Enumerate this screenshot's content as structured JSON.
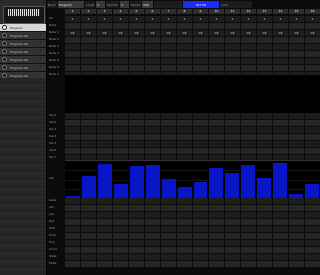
{
  "app": {
    "logo_mark": "",
    "logo_caption": "",
    "programs": [
      {
        "label": "Program",
        "active": true
      },
      {
        "label": "Program list",
        "active": false
      },
      {
        "label": "Program list",
        "active": false
      },
      {
        "label": "Program list",
        "active": false
      },
      {
        "label": "Program list",
        "active": false
      },
      {
        "label": "Program list",
        "active": false
      },
      {
        "label": "Program list",
        "active": false
      }
    ]
  },
  "header": {
    "bank_label": "Bank",
    "program_name": "Program",
    "level_label": "Level",
    "level_value": "1",
    "section_label": "Section",
    "section_value": "1",
    "tempo_label": "Tempo",
    "tempo_value": "120",
    "sync_badge": "INT 96",
    "extra_value": "1/16"
  },
  "columns": [
    "1",
    "2",
    "3",
    "4",
    "5",
    "6",
    "7",
    "8",
    "9",
    "10",
    "11",
    "12",
    "13",
    "14",
    "15",
    "16"
  ],
  "grid_top": {
    "rows": [
      {
        "label": "Ch",
        "values": [
          "1",
          "1",
          "1",
          "1",
          "1",
          "1",
          "1",
          "1",
          "1",
          "1",
          "1",
          "1",
          "1",
          "1",
          "1",
          "1"
        ]
      },
      {
        "label": "Note",
        "values": [
          "",
          "",
          "",
          "",
          "",
          "",
          "",
          "",
          "",
          "",
          "",
          "",
          "",
          "",
          "",
          ""
        ]
      },
      {
        "label": "Note 1",
        "values": [
          "C4",
          "C4",
          "C4",
          "C4",
          "C4",
          "C4",
          "C4",
          "C4",
          "C4",
          "C4",
          "C4",
          "C4",
          "C4",
          "C4",
          "C4",
          "C4"
        ]
      },
      {
        "label": "Note 2",
        "values": [
          "",
          "",
          "",
          "",
          "",
          "",
          "",
          "",
          "",
          "",
          "",
          "",
          "",
          "",
          "",
          ""
        ]
      },
      {
        "label": "Note 3",
        "values": [
          "",
          "",
          "",
          "",
          "",
          "",
          "",
          "",
          "",
          "",
          "",
          "",
          "",
          "",
          "",
          ""
        ]
      },
      {
        "label": "Note 4",
        "values": [
          "",
          "",
          "",
          "",
          "",
          "",
          "",
          "",
          "",
          "",
          "",
          "",
          "",
          "",
          "",
          ""
        ]
      },
      {
        "label": "Note 5",
        "values": [
          "",
          "",
          "",
          "",
          "",
          "",
          "",
          "",
          "",
          "",
          "",
          "",
          "",
          "",
          "",
          ""
        ]
      },
      {
        "label": "Note 6",
        "values": [
          "",
          "",
          "",
          "",
          "",
          "",
          "",
          "",
          "",
          "",
          "",
          "",
          "",
          "",
          "",
          ""
        ]
      },
      {
        "label": "Note 7",
        "values": [
          "",
          "",
          "",
          "",
          "",
          "",
          "",
          "",
          "",
          "",
          "",
          "",
          "",
          "",
          "",
          ""
        ]
      }
    ]
  },
  "grid_mid": {
    "rows": [
      {
        "label": "Vel 1",
        "values": [
          "",
          "",
          "",
          "",
          "",
          "",
          "",
          "",
          "",
          "",
          "",
          "",
          "",
          "",
          "",
          ""
        ]
      },
      {
        "label": "Vel 2",
        "values": [
          "",
          "",
          "",
          "",
          "",
          "",
          "",
          "",
          "",
          "",
          "",
          "",
          "",
          "",
          "",
          ""
        ]
      },
      {
        "label": "Vel 3",
        "values": [
          "",
          "",
          "",
          "",
          "",
          "",
          "",
          "",
          "",
          "",
          "",
          "",
          "",
          "",
          "",
          ""
        ]
      },
      {
        "label": "Vel 4",
        "values": [
          "",
          "",
          "",
          "",
          "",
          "",
          "",
          "",
          "",
          "",
          "",
          "",
          "",
          "",
          "",
          ""
        ]
      },
      {
        "label": "Vel 5",
        "values": [
          "",
          "",
          "",
          "",
          "",
          "",
          "",
          "",
          "",
          "",
          "",
          "",
          "",
          "",
          "",
          ""
        ]
      },
      {
        "label": "Vel 6",
        "values": [
          "",
          "",
          "",
          "",
          "",
          "",
          "",
          "",
          "",
          "",
          "",
          "",
          "",
          "",
          "",
          ""
        ]
      },
      {
        "label": "Vel 7",
        "values": [
          "",
          "",
          "",
          "",
          "",
          "",
          "",
          "",
          "",
          "",
          "",
          "",
          "",
          "",
          "",
          ""
        ]
      }
    ]
  },
  "bars": {
    "label": "Vel",
    "values": [
      0.05,
      0.62,
      0.95,
      0.38,
      0.88,
      0.92,
      0.52,
      0.3,
      0.45,
      0.82,
      0.7,
      0.93,
      0.55,
      0.98,
      0.12,
      0.4
    ]
  },
  "grid_bottom": {
    "rows": [
      {
        "label": "Gate",
        "values": [
          "",
          "",
          "",
          "",
          "",
          "",
          "",
          "",
          "",
          "",
          "",
          "",
          "",
          "",
          "",
          ""
        ]
      },
      {
        "label": "Vel",
        "values": [
          "",
          "",
          "",
          "",
          "",
          "",
          "",
          "",
          "",
          "",
          "",
          "",
          "",
          "",
          "",
          ""
        ]
      },
      {
        "label": "Len",
        "values": [
          "",
          "",
          "",
          "",
          "",
          "",
          "",
          "",
          "",
          "",
          "",
          "",
          "",
          "",
          "",
          ""
        ]
      },
      {
        "label": "Rpt",
        "values": [
          "",
          "",
          "",
          "",
          "",
          "",
          "",
          "",
          "",
          "",
          "",
          "",
          "",
          "",
          "",
          ""
        ]
      },
      {
        "label": "Mod",
        "values": [
          "",
          "",
          "",
          "",
          "",
          "",
          "",
          "",
          "",
          "",
          "",
          "",
          "",
          "",
          "",
          ""
        ]
      },
      {
        "label": "Prob",
        "values": [
          "",
          "",
          "",
          "",
          "",
          "",
          "",
          "",
          "",
          "",
          "",
          "",
          "",
          "",
          "",
          ""
        ]
      },
      {
        "label": "Trig",
        "values": [
          "",
          "",
          "",
          "",
          "",
          "",
          "",
          "",
          "",
          "",
          "",
          "",
          "",
          "",
          "",
          ""
        ]
      },
      {
        "label": "Cond",
        "values": [
          "",
          "",
          "",
          "",
          "",
          "",
          "",
          "",
          "",
          "",
          "",
          "",
          "",
          "",
          "",
          ""
        ]
      },
      {
        "label": "Slide",
        "values": [
          "",
          "",
          "",
          "",
          "",
          "",
          "",
          "",
          "",
          "",
          "",
          "",
          "",
          "",
          "",
          ""
        ]
      },
      {
        "label": "Mute",
        "values": [
          "",
          "",
          "",
          "",
          "",
          "",
          "",
          "",
          "",
          "",
          "",
          "",
          "",
          "",
          "",
          ""
        ]
      }
    ]
  }
}
